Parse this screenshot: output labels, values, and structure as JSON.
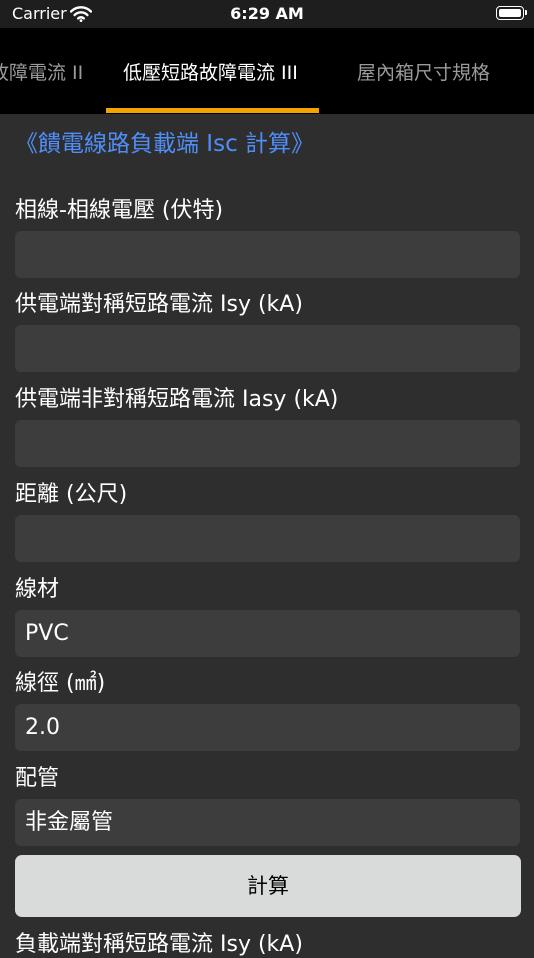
{
  "status_bar": {
    "carrier": "Carrier",
    "time": "6:29 AM",
    "wifi_icon": "wifi-icon",
    "battery_icon": "battery-icon"
  },
  "tabs": [
    {
      "label": "故障電流 II",
      "active": false
    },
    {
      "label": "低壓短路故障電流 III",
      "active": true
    },
    {
      "label": "屋內箱尺寸規格",
      "active": false
    }
  ],
  "colors": {
    "accent": "#f5a300",
    "link": "#4f8ef7",
    "background": "#2e2e2e",
    "field": "#3d3d3d"
  },
  "form": {
    "title": "《饋電線路負載端 Isc 計算》",
    "fields": [
      {
        "label": "相線-相線電壓 (伏特)",
        "value": ""
      },
      {
        "label": "供電端對稱短路電流 Isy (kA)",
        "value": ""
      },
      {
        "label": "供電端非對稱短路電流 Iasy (kA)",
        "value": ""
      },
      {
        "label": "距離 (公尺)",
        "value": ""
      },
      {
        "label": "線材",
        "value": "PVC"
      },
      {
        "label": "線徑 (㎟)",
        "value": "2.0"
      },
      {
        "label": "配管",
        "value": "非金屬管"
      }
    ],
    "calculate_label": "計算",
    "result_label": "負載端對稱短路電流 Isy (kA)"
  }
}
